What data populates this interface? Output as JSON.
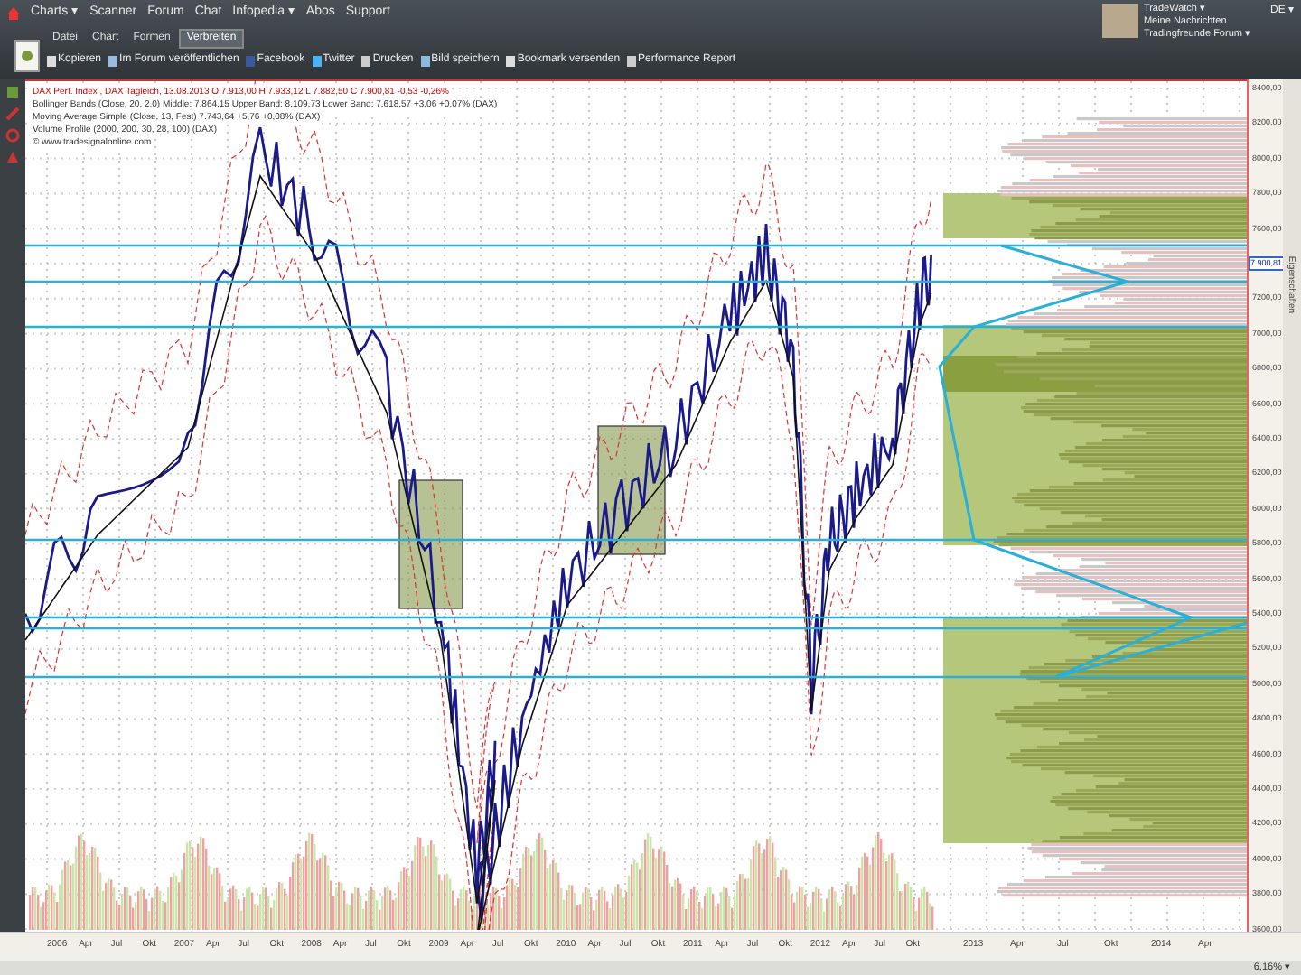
{
  "menu": [
    {
      "label": "Charts ▾"
    },
    {
      "label": "Scanner"
    },
    {
      "label": "Forum"
    },
    {
      "label": "Chat"
    },
    {
      "label": "Infopedia ▾"
    },
    {
      "label": "Abos"
    },
    {
      "label": "Support"
    }
  ],
  "user": {
    "links": [
      "TradeWatch ▾",
      "Meine Nachrichten",
      "Tradingfreunde Forum ▾"
    ],
    "language": "DE ▾"
  },
  "tabs": [
    {
      "label": "Datei",
      "selected": false
    },
    {
      "label": "Chart",
      "selected": false
    },
    {
      "label": "Formen",
      "selected": false
    },
    {
      "label": "Verbreiten",
      "selected": true
    }
  ],
  "toolbar": [
    "Kopieren",
    "Im Forum veröffentlichen",
    "Facebook",
    "Twitter",
    "Drucken",
    "Bild speichern",
    "Bookmark versenden",
    "Performance Report"
  ],
  "legend": [
    "DAX Perf. Index , DAX Tagleich, 13.08.2013 O 7.913,00 H 7.933,12 L 7.882,50 C 7.900,81 -0,53 -0,26%",
    "Bollinger Bands (Close, 20, 2,0) Middle: 7.864,15 Upper Band: 8.109,73 Lower Band: 7.618,57 +3,06 +0,07% (DAX)",
    "Moving Average Simple (Close, 13, Fest) 7.743,64 +5,76 +0,08% (DAX)",
    "Volume Profile (2000, 200, 30, 28, 100) (DAX)",
    "© www.tradesignalonline.com"
  ],
  "price_axis": [
    {
      "kind": "tick",
      "label": "8400,00"
    },
    {
      "kind": "tick",
      "label": "8200,00"
    },
    {
      "kind": "tick",
      "label": "8000,00"
    },
    {
      "kind": "tick",
      "label": "7800,00"
    },
    {
      "kind": "tick",
      "label": "7600,00"
    },
    {
      "kind": "last_price",
      "label": "7.900,81"
    },
    {
      "kind": "tick",
      "label": "7200,00"
    },
    {
      "kind": "tick",
      "label": "7000,00"
    },
    {
      "kind": "tick",
      "label": "6800,00"
    },
    {
      "kind": "tick",
      "label": "6600,00"
    },
    {
      "kind": "tick",
      "label": "6400,00"
    },
    {
      "kind": "tick",
      "label": "6200,00"
    },
    {
      "kind": "tick",
      "label": "6000,00"
    },
    {
      "kind": "tick",
      "label": "5800,00"
    },
    {
      "kind": "tick",
      "label": "5600,00"
    },
    {
      "kind": "tick",
      "label": "5400,00"
    },
    {
      "kind": "tick",
      "label": "5200,00"
    },
    {
      "kind": "tick",
      "label": "5000,00"
    },
    {
      "kind": "tick",
      "label": "4800,00"
    },
    {
      "kind": "tick",
      "label": "4600,00"
    },
    {
      "kind": "tick",
      "label": "4400,00"
    },
    {
      "kind": "tick",
      "label": "4200,00"
    },
    {
      "kind": "tick",
      "label": "4000,00"
    },
    {
      "kind": "tick",
      "label": "3800,00"
    },
    {
      "kind": "tick",
      "label": "3600,00"
    }
  ],
  "time_axis": [
    "2006",
    "Apr",
    "Jul",
    "Okt",
    "2007",
    "Apr",
    "Jul",
    "Okt",
    "2008",
    "Apr",
    "Jul",
    "Okt",
    "2009",
    "Apr",
    "Jul",
    "Okt",
    "2010",
    "Apr",
    "Jul",
    "Okt",
    "2011",
    "Apr",
    "Jul",
    "Okt",
    "2012",
    "Apr",
    "Jul",
    "Okt",
    "2013",
    "Apr",
    "Jul",
    "Okt",
    "2014",
    "Apr"
  ],
  "side_panel": "Eigenschaften",
  "zoom": "6,16% ▾"
}
